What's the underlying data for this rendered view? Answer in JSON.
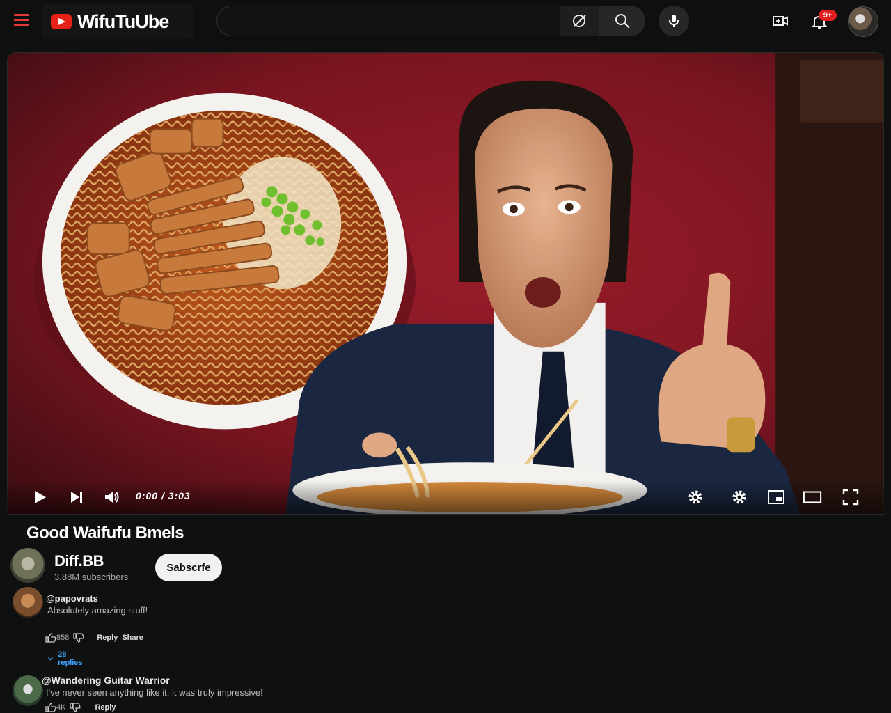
{
  "header": {
    "logo_text": "WifuTuUbe",
    "search_placeholder": "",
    "notification_badge": "9+",
    "icons": [
      "menu-icon",
      "clear-search-icon",
      "search-icon",
      "mic-icon",
      "create-video-icon",
      "bell-icon",
      "avatar"
    ]
  },
  "player": {
    "time": "0:00 / 3:03",
    "scene": "bowl of ramen with fried pieces and green onions; man in dark suit giving a thumbs up over a second noodle bowl",
    "icons": [
      "play-icon",
      "next-icon",
      "volume-icon",
      "settings-icon",
      "settings-icon",
      "miniplayer-icon",
      "theater-icon",
      "fullscreen-icon"
    ]
  },
  "video": {
    "title": "Good Waifufu Bmels"
  },
  "channel": {
    "name": "Diff.BB",
    "subscribers": "3.88M subscribers",
    "subscribe_label": "Sabscrfe"
  },
  "comments": [
    {
      "author": "@papovrats",
      "text": "Absolutely amazing stuff!",
      "likes": "858",
      "reply_label": "Reply",
      "extra_label": "Share",
      "replies_label": "28 replies"
    },
    {
      "author": "@Wandering Guitar Warrior",
      "text": "I've never seen anything like it, it was truly impressive!",
      "likes": "4K",
      "reply_label": "Reply"
    }
  ],
  "colors": {
    "background": "#0f1111",
    "brand_red": "#e62117",
    "wall_red": "#8a1a24",
    "link_blue": "#3ea6ff"
  }
}
